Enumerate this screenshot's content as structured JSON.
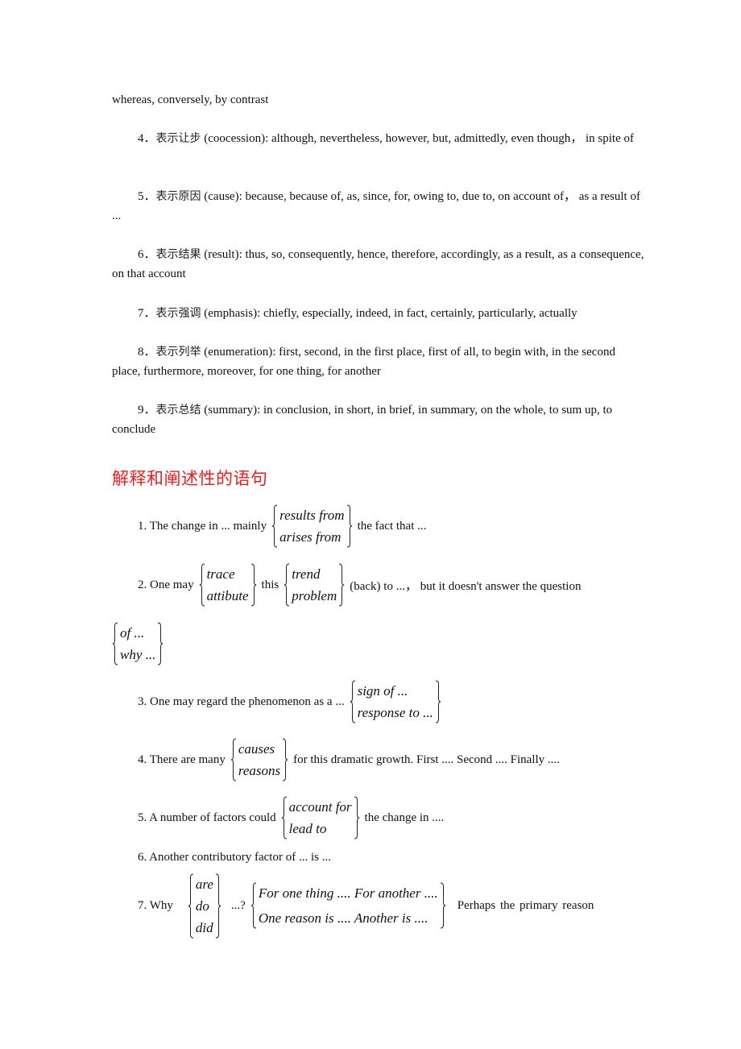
{
  "connectives": {
    "continued_line": "whereas, conversely, by contrast",
    "items": [
      {
        "num": "4．",
        "zh": "表示让步",
        "text": " (coocession): although, nevertheless, however, but, admittedly, even though，   in spite of"
      },
      {
        "num": "5．",
        "zh": "表示原因",
        "text": " (cause): because, because of, as, since, for, owing to, due to, on account of，   as a result of ..."
      },
      {
        "num": "6．",
        "zh": "表示结果",
        "text": " (result): thus, so, consequently, hence, therefore, accordingly, as a result, as a consequence, on that account"
      },
      {
        "num": "7．",
        "zh": "表示强调",
        "text": " (emphasis): chiefly, especially, indeed, in fact, certainly, particularly, actually"
      },
      {
        "num": "8．",
        "zh": "表示列举",
        "text": " (enumeration): first, second, in the first place, first of all, to begin with, in the second place, furthermore, moreover, for one thing, for another"
      },
      {
        "num": "9．",
        "zh": "表示总结",
        "text": " (summary): in conclusion, in short, in brief, in summary, on the whole, to sum up, to conclude"
      }
    ]
  },
  "section_heading": "解释和阐述性的语句",
  "sentences": {
    "s1": {
      "pre": "1. The change in ... mainly",
      "opts": [
        "results  from",
        "arises  from"
      ],
      "post": "the fact that ..."
    },
    "s2": {
      "pre": "2. One may",
      "opts1": [
        "trace",
        "attibute"
      ],
      "mid": "this",
      "opts2": [
        "trend",
        "problem"
      ],
      "post": "(back) to ...，  but it doesn't answer the question",
      "cont_opts": [
        "of ...",
        "why ..."
      ]
    },
    "s3": {
      "pre": "3. One may regard the phenomenon as a ...",
      "opts": [
        "sign of  ...",
        "response to ..."
      ]
    },
    "s4": {
      "pre": "4. There are many",
      "opts": [
        "causes",
        "reasons"
      ],
      "post": "for this dramatic growth. First .... Second .... Finally ...."
    },
    "s5": {
      "pre": "5. A number of factors could",
      "opts": [
        "account  for",
        "lead to"
      ],
      "post": "the change in ...."
    },
    "s6": {
      "text": "6. Another contributory factor of ... is ..."
    },
    "s7": {
      "pre": "7.  Why",
      "opts1": [
        "are",
        "do",
        "did"
      ],
      "mid": "...?",
      "opts2": [
        "For one thing .... For another ....",
        "One reason is .... Another is ...."
      ],
      "post": "Perhaps  the  primary  reason"
    }
  }
}
